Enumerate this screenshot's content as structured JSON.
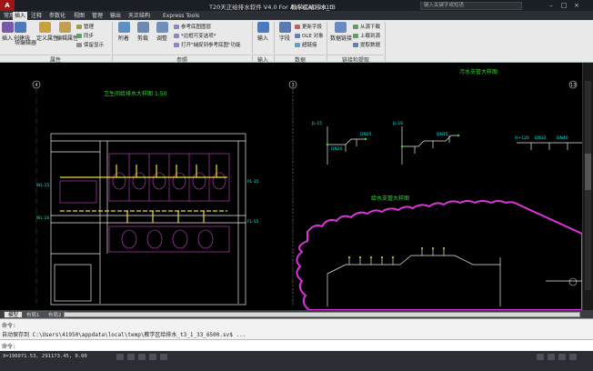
{
  "titlebar": {
    "app_title": "T20天正给排水软件 V4.0 For AutoCAD 2010",
    "doc_title": "教学区给排水_t3",
    "search_placeholder": "键入关键字或短语",
    "logo": "A"
  },
  "menu": {
    "items": [
      "常用",
      "插入",
      "注释",
      "参数化",
      "视图",
      "管理",
      "输出",
      "天正结构",
      "Express Tools"
    ],
    "active_index": 1
  },
  "ribbon": {
    "buttons": [
      {
        "label": "插入",
        "color": "#7a5aa8"
      },
      {
        "label": "创建块",
        "color": "#5078b8"
      },
      {
        "label": "块编辑器",
        "color": "#5a82c0"
      },
      {
        "label": "定义属性",
        "color": "#c8a040"
      },
      {
        "label": "编辑属性",
        "color": "#c0a050"
      },
      {
        "label": "附着",
        "color": "#6090c0"
      },
      {
        "label": "剪裁",
        "color": "#6a8ab0"
      },
      {
        "label": "调整",
        "color": "#7090b8"
      },
      {
        "label": "输入",
        "color": "#4a7ac0"
      },
      {
        "label": "字段",
        "color": "#5a7ab0"
      },
      {
        "label": "数据链接",
        "color": "#6a8ac0"
      }
    ],
    "small": [
      {
        "label": "管理",
        "color": "#a0a040"
      },
      {
        "label": "同步",
        "color": "#60a060"
      },
      {
        "label": "保留显示",
        "color": "#909090"
      },
      {
        "label": "参考底图图层",
        "color": "#8888cc"
      },
      {
        "label": "*边框可变选项*",
        "color": "#8888cc"
      },
      {
        "label": "打开\"捕捉到参考底图\"功能",
        "color": "#8888cc"
      },
      {
        "label": "更新字段",
        "color": "#c06060"
      },
      {
        "label": "OLE 对象",
        "color": "#6080c0"
      },
      {
        "label": "超链接",
        "color": "#60a0c0"
      },
      {
        "label": "从源下载",
        "color": "#60a060"
      },
      {
        "label": "上载到源",
        "color": "#60a060"
      },
      {
        "label": "提取数据",
        "color": "#6080b0"
      }
    ],
    "groups": [
      "属性",
      "参照",
      "输入",
      "数据",
      "链接和提取"
    ]
  },
  "drawing": {
    "label_toilet": "卫生间给排水大样图 1:50",
    "label_sewage": "污水支管大样图",
    "label_supply": "给水支管大样图",
    "axis_marks": [
      "4",
      "3",
      "13"
    ],
    "pipe_labels": [
      "JL-15",
      "JL-16",
      "DN25",
      "DN20",
      "DN32",
      "DN40",
      "H+120",
      "DN15",
      "WL-15",
      "WL-16",
      "PL-15",
      "FL-15"
    ]
  },
  "layout_tabs": [
    "模型",
    "布局1",
    "布局2"
  ],
  "command": {
    "line1": "命令:",
    "line2": "自动保存到 C:\\Users\\41950\\appdata\\local\\temp\\教学区给排水_t3_1_33_6500.sv$ ...",
    "prompt": "命令:"
  },
  "status": {
    "coord": "X=196071.53, 291173.45, 0.00"
  }
}
